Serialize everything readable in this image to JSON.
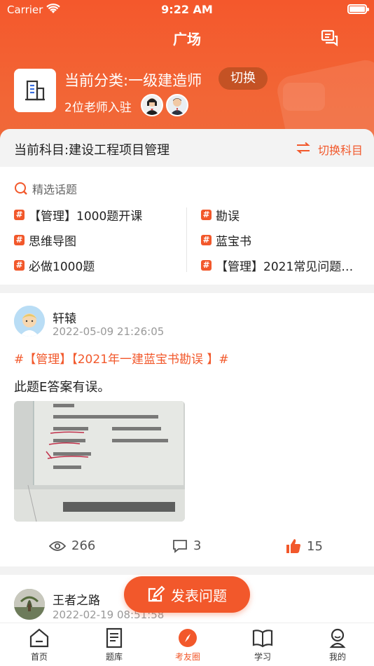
{
  "status_bar": {
    "carrier": "Carrier",
    "time": "9:22 AM"
  },
  "nav": {
    "title": "广场"
  },
  "category": {
    "label": "当前分类:一级建造师",
    "switch_label": "切换",
    "teachers_label": "2位老师入驻"
  },
  "subject": {
    "label": "当前科目:建设工程项目管理",
    "switch_label": "切换科目"
  },
  "topics": {
    "header": "精选话题",
    "left": [
      "【管理】1000题开课",
      "思维导图",
      "必做1000题"
    ],
    "right": [
      "勘误",
      "蓝宝书",
      "【管理】2021常见问题…"
    ]
  },
  "post": {
    "username": "轩辕",
    "time": "2022-05-09 21:26:05",
    "tags": "#【管理】【2021年一建蓝宝书勘误 】#",
    "text": "此题E答案有误。",
    "views": "266",
    "comments": "3",
    "likes": "15"
  },
  "post2": {
    "username": "王者之路",
    "time": "2022-02-19 08:51:58"
  },
  "fab": {
    "label": "发表问题"
  },
  "tabbar": {
    "items": [
      {
        "label": "首页",
        "icon": "home-icon"
      },
      {
        "label": "题库",
        "icon": "question-bank-icon"
      },
      {
        "label": "考友圈",
        "icon": "compass-icon"
      },
      {
        "label": "学习",
        "icon": "book-icon"
      },
      {
        "label": "我的",
        "icon": "profile-icon"
      }
    ],
    "active_index": 2
  },
  "colors": {
    "accent": "#f2582b",
    "header": "#f4582c"
  }
}
